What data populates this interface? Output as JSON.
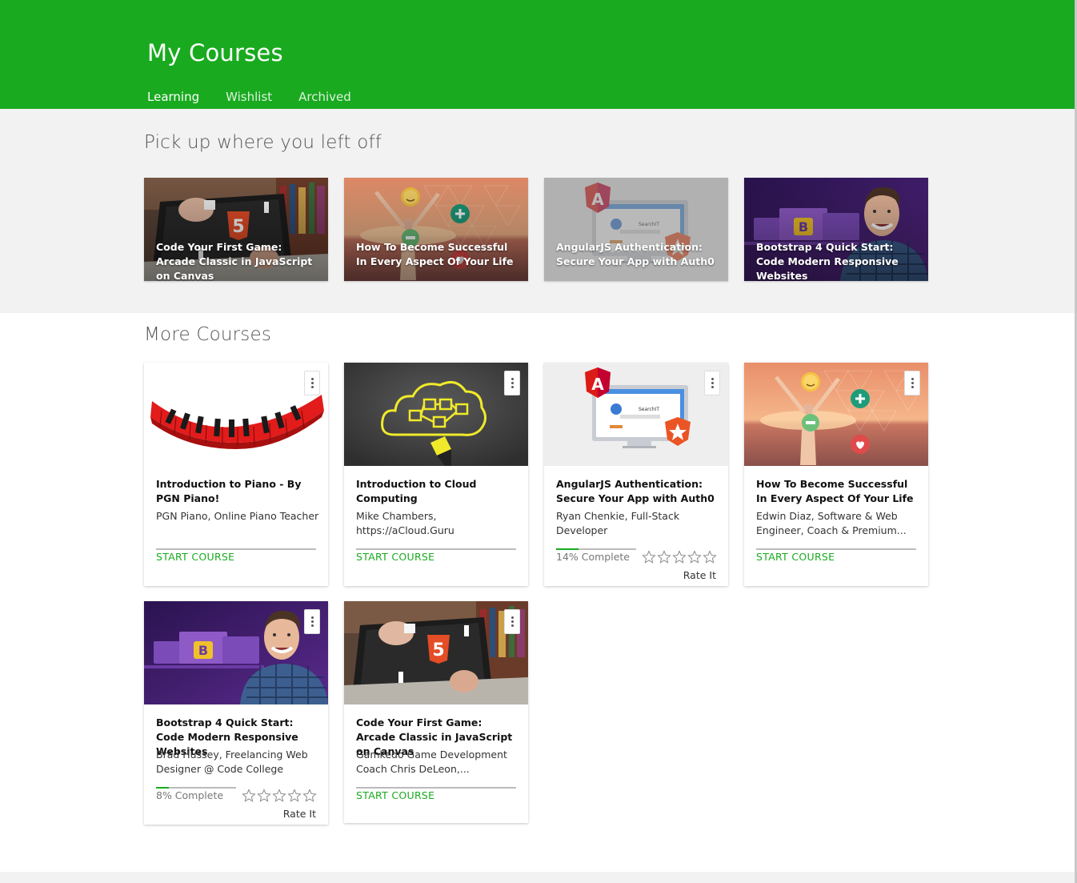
{
  "header": {
    "title": "My Courses",
    "tabs": [
      {
        "label": "Learning",
        "active": true
      },
      {
        "label": "Wishlist",
        "active": false
      },
      {
        "label": "Archived",
        "active": false
      }
    ]
  },
  "resume_section": {
    "title": "Pick up where you left off",
    "courses": [
      {
        "title": "Code Your First Game: Arcade Classic in JavaScript on Canvas",
        "image": "laptop-html5-game"
      },
      {
        "title": "How To Become Successful In Every Aspect Of Your Life",
        "image": "sunset-success"
      },
      {
        "title": "AngularJS Authentication: Secure Your App with Auth0",
        "image": "angular-auth0"
      },
      {
        "title": "Bootstrap 4 Quick Start: Code Modern Responsive Websites",
        "image": "bootstrap-instructor"
      }
    ]
  },
  "more_section": {
    "title": "More Courses",
    "courses": [
      {
        "title": "Introduction to Piano - By PGN Piano!",
        "author": "PGN Piano, Online Piano Teacher",
        "action": "START COURSE",
        "progress": 0,
        "image": "piano-keys"
      },
      {
        "title": "Introduction to Cloud Computing",
        "author": "Mike Chambers, https://aCloud.Guru",
        "action": "START COURSE",
        "progress": 0,
        "image": "cloud-sketch"
      },
      {
        "title": "AngularJS Authentication: Secure Your App with Auth0",
        "author": "Ryan Chenkie, Full-Stack Developer",
        "progress_label": "14% Complete",
        "progress": 0.14,
        "rate_label": "Rate It",
        "image": "angular-auth0"
      },
      {
        "title": "How To Become Successful In Every Aspect Of Your Life",
        "author": "Edwin Diaz, Software & Web Engineer, Coach & Premium...",
        "action": "START COURSE",
        "progress": 0,
        "image": "sunset-success"
      },
      {
        "title": "Bootstrap 4 Quick Start: Code Modern Responsive Websites",
        "author": "Brad Hussey, Freelancing Web Designer @ Code College",
        "progress_label": "8% Complete",
        "progress": 0.08,
        "rate_label": "Rate It",
        "image": "bootstrap-instructor"
      },
      {
        "title": "Code Your First Game: Arcade Classic in JavaScript on Canvas",
        "author": "Gamkedo Game Development Coach Chris DeLeon,...",
        "action": "START COURSE",
        "progress": 0,
        "image": "laptop-html5-game"
      }
    ]
  },
  "colors": {
    "brand_green": "#19aa1f",
    "section_bg": "#f2f2f2"
  },
  "icons": [
    "kebab-menu-icon",
    "star-outline-icon",
    "html5-logo-icon",
    "angular-logo-icon",
    "bootstrap-logo-icon",
    "auth0-logo-icon"
  ]
}
